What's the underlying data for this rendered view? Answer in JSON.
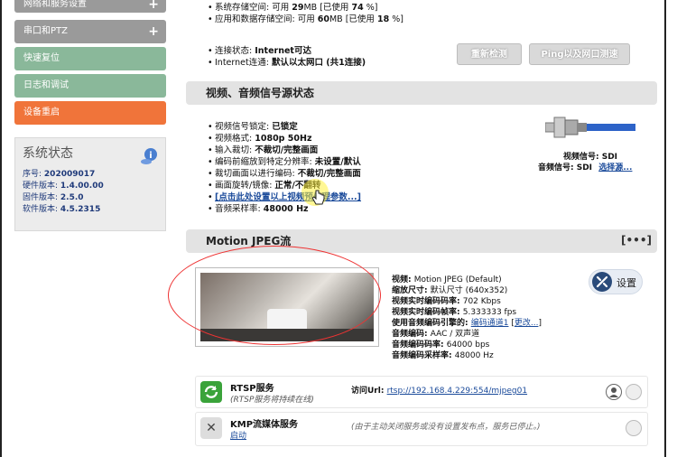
{
  "sidebar": {
    "items": [
      {
        "label": "网络和服务设置",
        "color": "#9a9a9a",
        "expand": "+"
      },
      {
        "label": "串口和PTZ",
        "color": "#9a9a9a",
        "expand": "+"
      },
      {
        "label": "快速复位",
        "color": "#8ab89a"
      },
      {
        "label": "日志和调试",
        "color": "#8ab89a"
      },
      {
        "label": "设备重启",
        "color": "#f0743a"
      }
    ],
    "status": {
      "title": "系统状态",
      "rows": [
        {
          "k": "序号:",
          "v": "202009017"
        },
        {
          "k": "硬件版本:",
          "v": "1.4.00.00"
        },
        {
          "k": "固件版本:",
          "v": "2.5.0"
        },
        {
          "k": "软件版本:",
          "v": "4.5.2315"
        }
      ]
    }
  },
  "storage": {
    "sys_pre": "系统存储空间: 可用 ",
    "sys_avail": "29",
    "sys_post": "MB [已使用 ",
    "sys_used": "74",
    "sys_end": " %]",
    "app_pre": "应用和数据存储空间: 可用 ",
    "app_avail": "60",
    "app_post": "MB [已使用 ",
    "app_used": "18",
    "app_end": " %]"
  },
  "network": {
    "conn_label": "连接状态: ",
    "conn_value": "Internet可达",
    "inet_label": "Internet连通: ",
    "inet_value": "默认以太网口 (共1连接)",
    "recheck_btn": "重新检测",
    "ping_btn": "Ping以及网口测速"
  },
  "signal": {
    "header": "视频、音频信号源状态",
    "rows": [
      {
        "k": "视频信号锁定: ",
        "v": "已锁定"
      },
      {
        "k": "视频格式: ",
        "v": "1080p 50Hz"
      },
      {
        "k": "输入裁切: ",
        "v": "不裁切/完整画面"
      },
      {
        "k": "编码前缩放到特定分辨率: ",
        "v": "未设置/默认"
      },
      {
        "k": "裁切画面以进行编码: ",
        "v": "不裁切/完整画面"
      },
      {
        "k": "画面旋转/镜像: ",
        "v": "正常/不翻转"
      }
    ],
    "settings_link": "[点击此处设置以上视频预处理参数...]",
    "audio_rate_label": "音频采样率: ",
    "audio_rate_value": "48000 Hz",
    "video_sig": "视频信号: SDI",
    "audio_sig": "音频信号: SDI",
    "select_src": "选择源..."
  },
  "mjpeg": {
    "header": "Motion JPEG流",
    "menu": "[•••]",
    "settings_btn": "设置",
    "info": [
      {
        "k": "视频: ",
        "v": "Motion JPEG (Default)"
      },
      {
        "k": "缩放尺寸: ",
        "v": "默认尺寸 (640x352)"
      },
      {
        "k": "视频实时编码码率: ",
        "v": "702 Kbps"
      },
      {
        "k": "视频实时编码帧率: ",
        "v": "5.333333 fps"
      },
      {
        "k": "使用音频编码引擎的: ",
        "v": "编码通道1"
      },
      {
        "k": "音频编码: ",
        "v": "AAC / 双声道"
      },
      {
        "k": "音频编码码率: ",
        "v": "64000 bps"
      },
      {
        "k": "音频编码采样率: ",
        "v": "48000 Hz"
      }
    ],
    "change_link": "更改..."
  },
  "services": [
    {
      "title": "RTSP服务",
      "sub": "(RTSP服务将持续在线)",
      "url_label": "访问Url: ",
      "url": "rtsp://192.168.4.229:554/mjpeg01",
      "icon": "refresh-icon",
      "color": "#3aa33a"
    },
    {
      "title": "KMP流媒体服务",
      "sub": "启动",
      "note": "(由于主动关闭服务或没有设置发布点，服务已停止。)",
      "icon": "x-icon",
      "color": "#ddd"
    }
  ]
}
